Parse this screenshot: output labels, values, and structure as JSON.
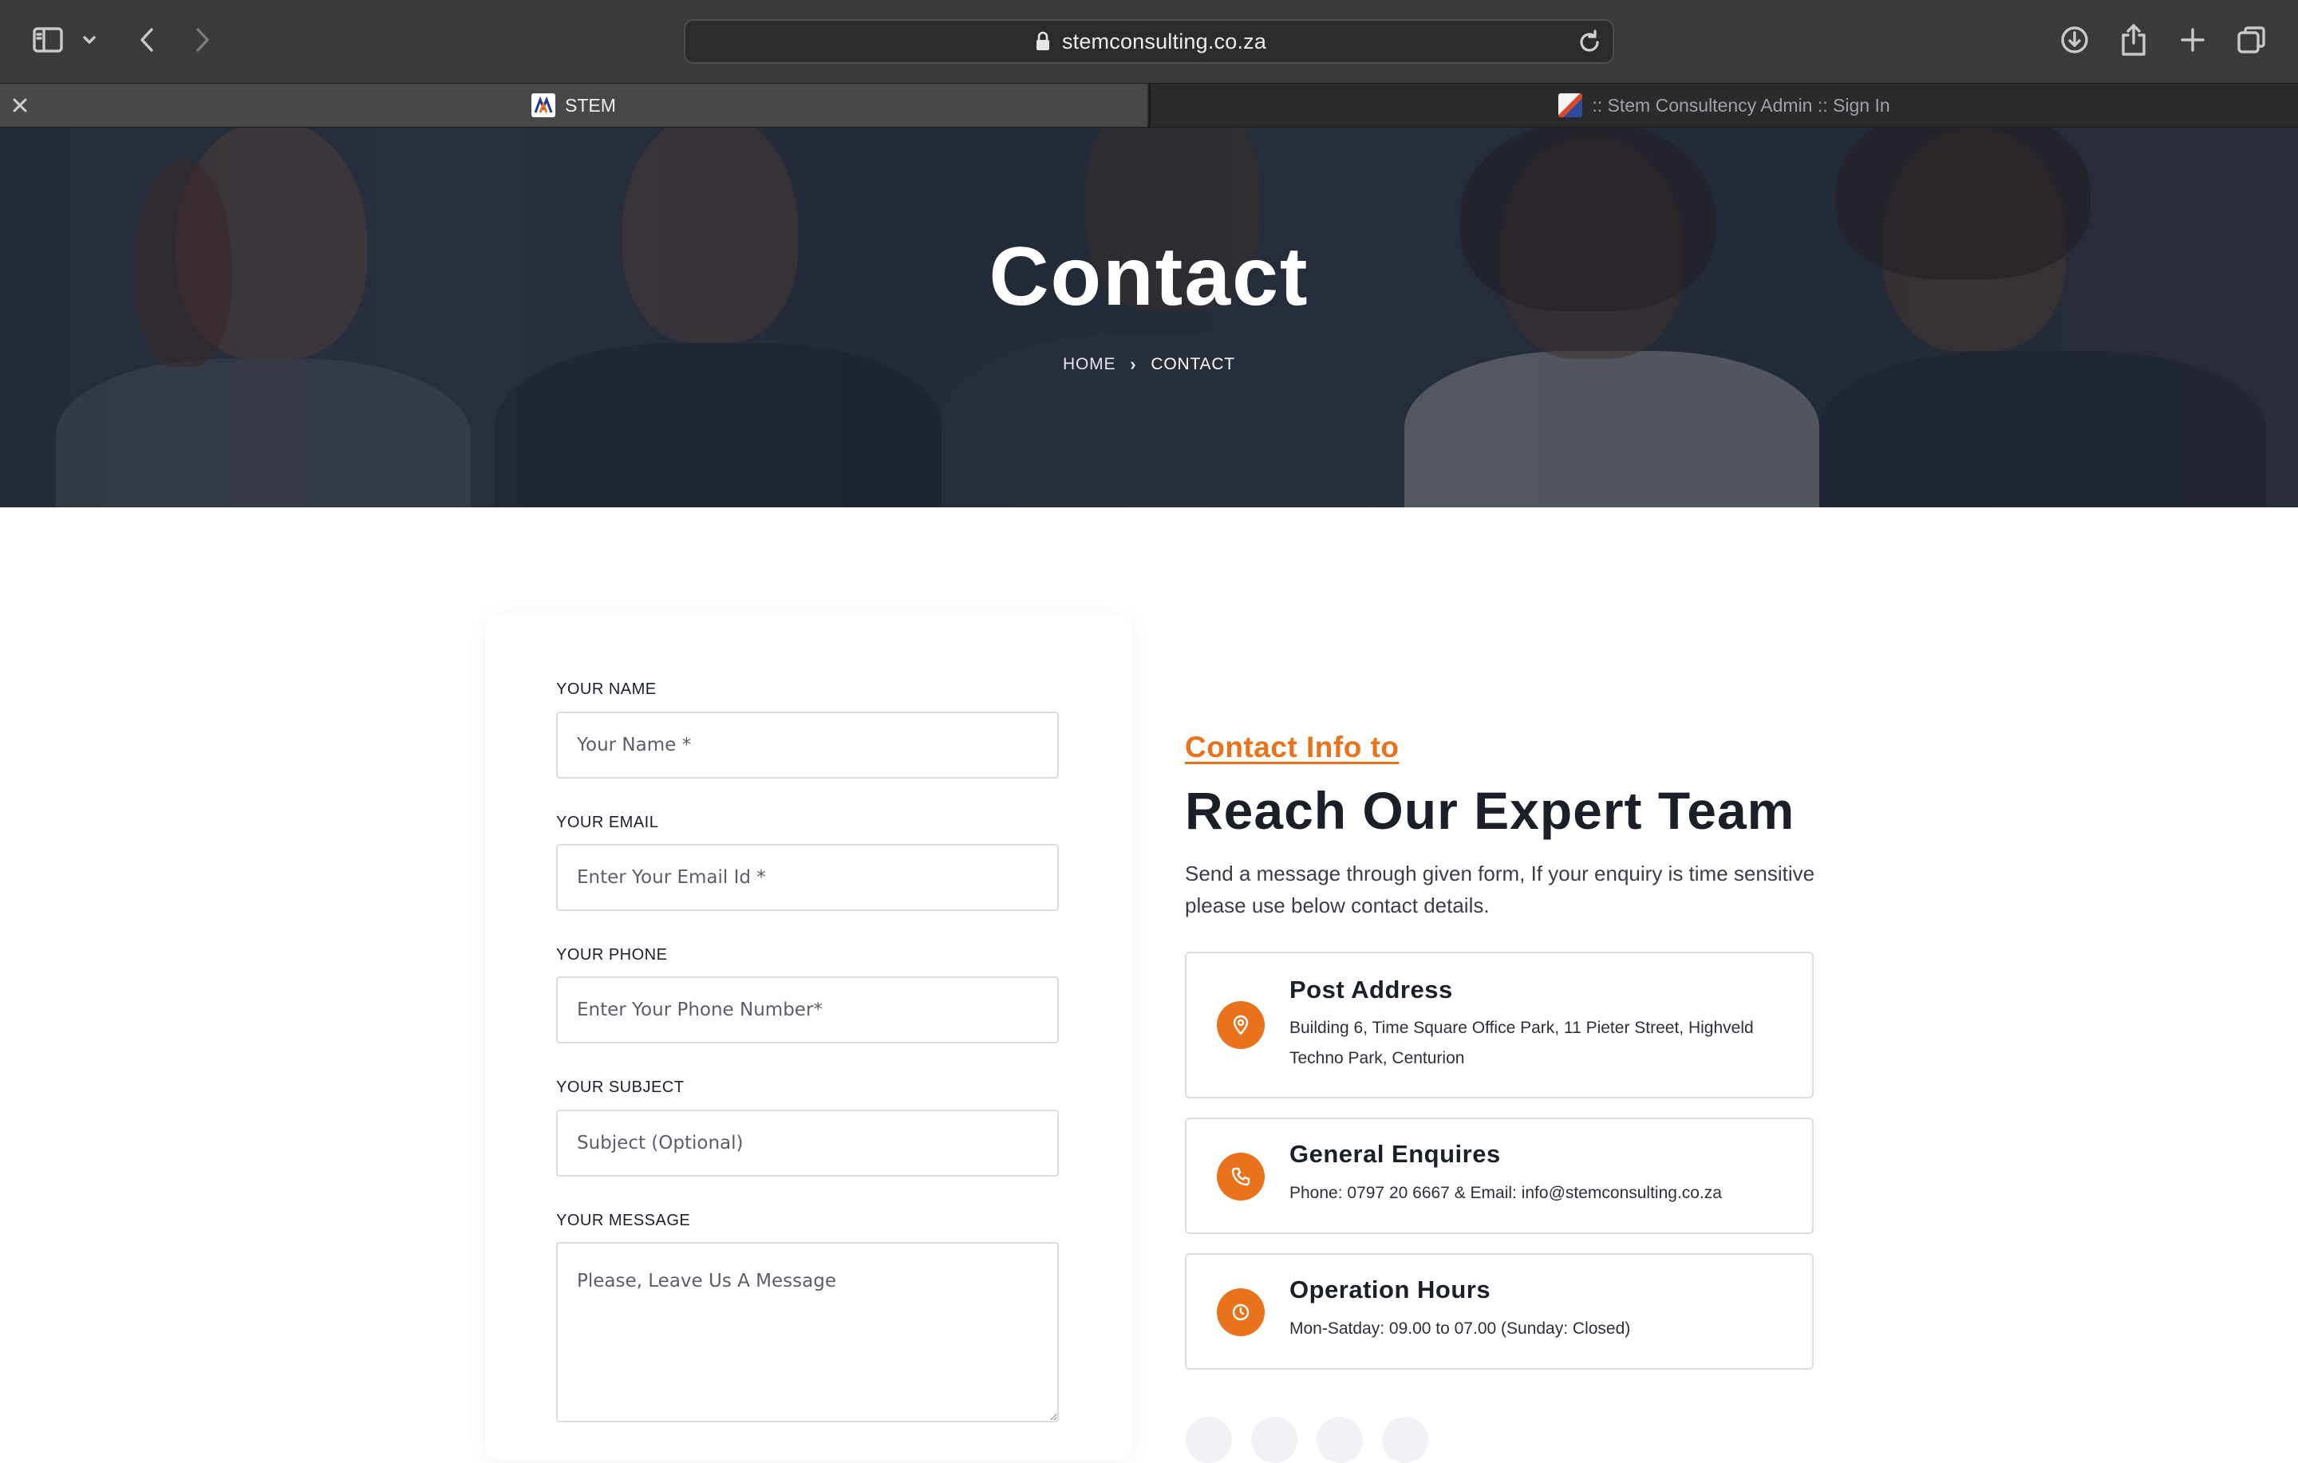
{
  "browser": {
    "url": "stemconsulting.co.za",
    "tabs": [
      {
        "label": "STEM",
        "active": true
      },
      {
        "label": ":: Stem Consultency Admin :: Sign In",
        "active": false
      }
    ]
  },
  "hero": {
    "title": "Contact",
    "breadcrumb": {
      "home": "HOME",
      "current": "CONTACT"
    }
  },
  "form": {
    "name_label": "YOUR NAME",
    "name_placeholder": "Your Name *",
    "email_label": "YOUR EMAIL",
    "email_placeholder": "Enter Your Email Id *",
    "phone_label": "YOUR PHONE",
    "phone_placeholder": "Enter Your Phone Number*",
    "subject_label": "YOUR SUBJECT",
    "subject_placeholder": "Subject (Optional)",
    "message_label": "YOUR MESSAGE",
    "message_placeholder": "Please, Leave Us A Message"
  },
  "info": {
    "kicker": "Contact Info to",
    "heading": "Reach Our Expert Team",
    "lead": "Send a message through given form, If your enquiry is time sensitive please use below contact details.",
    "cards": [
      {
        "icon": "map-pin-icon",
        "title": "Post Address",
        "text": "Building 6, Time Square Office Park, 11 Pieter Street, Highveld Techno Park, Centurion"
      },
      {
        "icon": "phone-icon",
        "title": "General Enquires",
        "text": "Phone: 0797 20 6667 & Email: info@stemconsulting.co.za"
      },
      {
        "icon": "clock-icon",
        "title": "Operation Hours",
        "text": "Mon-Satday: 09.00 to 07.00 (Sunday: Closed)"
      }
    ]
  },
  "colors": {
    "accent": "#e8731c",
    "text_dark": "#1b1f2a",
    "browser_bg": "#3b3b3d"
  }
}
